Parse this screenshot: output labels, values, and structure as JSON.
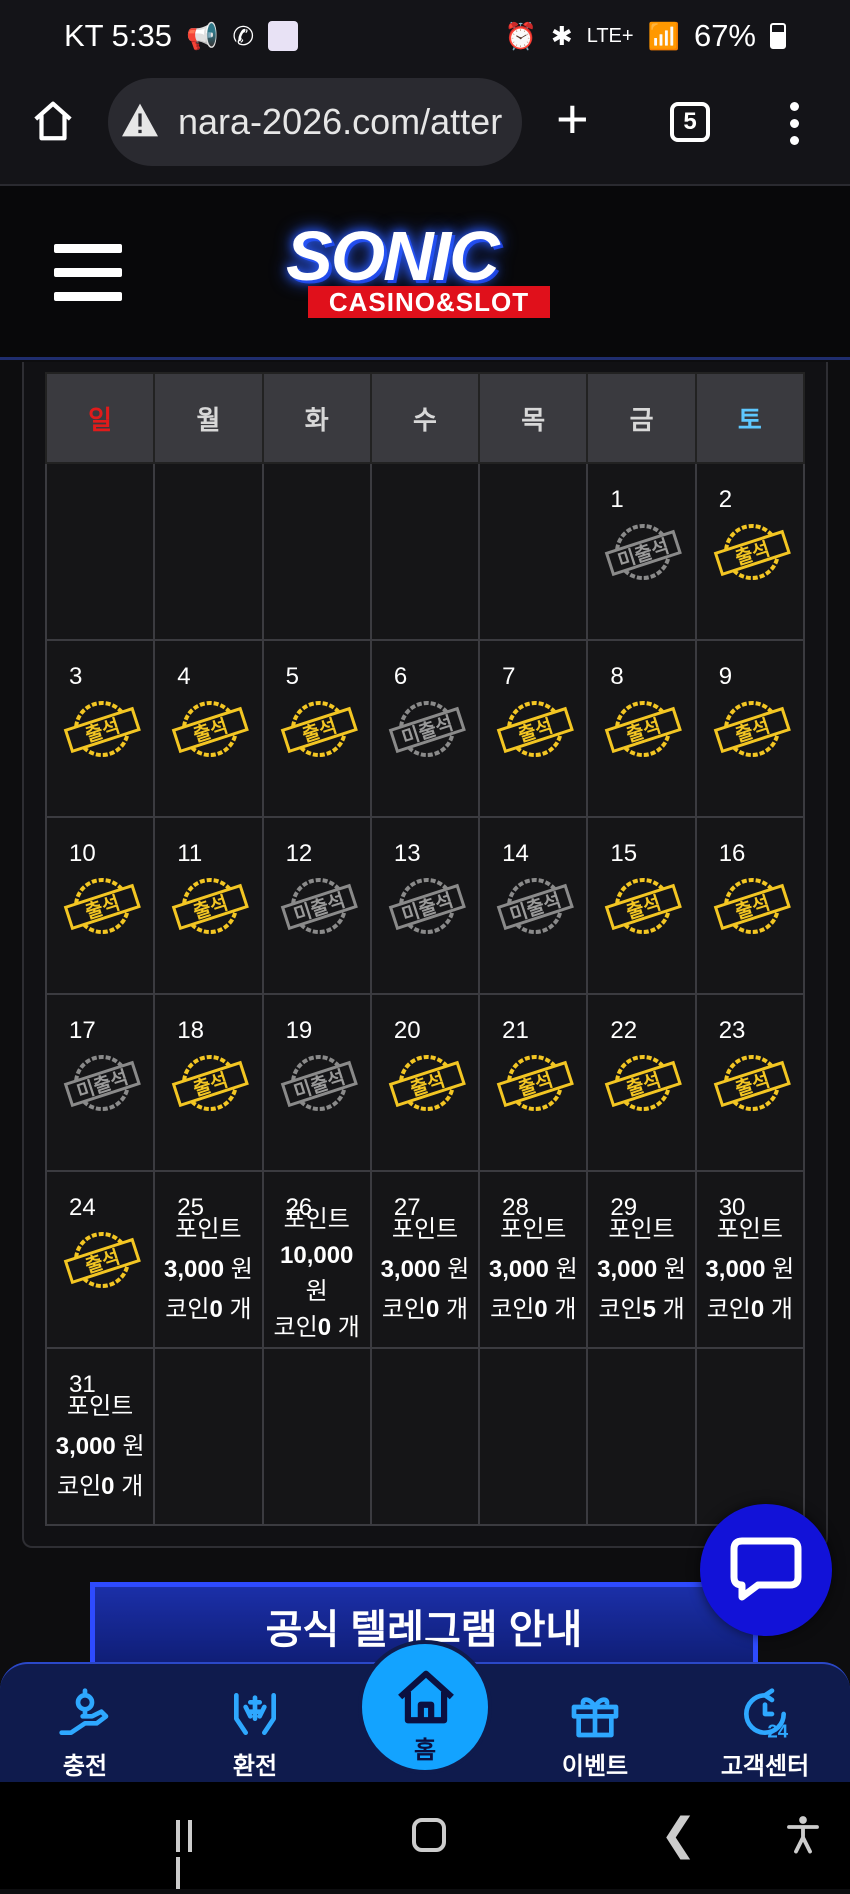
{
  "status_bar": {
    "carrier_time": "KT 5:35",
    "network": "LTE+",
    "battery": "67%"
  },
  "browser": {
    "url": "nara-2026.com/atter",
    "tab_count": "5"
  },
  "site": {
    "logo_word": "SONIC",
    "logo_sub": "CASINO&SLOT"
  },
  "calendar": {
    "weekdays": [
      "일",
      "월",
      "화",
      "수",
      "목",
      "금",
      "토"
    ],
    "attended_label": "출석",
    "missed_label": "미출석",
    "weeks": [
      [
        null,
        null,
        null,
        null,
        null,
        {
          "day": "1",
          "status": "missed"
        },
        {
          "day": "2",
          "status": "attended"
        }
      ],
      [
        {
          "day": "3",
          "status": "attended"
        },
        {
          "day": "4",
          "status": "attended"
        },
        {
          "day": "5",
          "status": "attended"
        },
        {
          "day": "6",
          "status": "missed"
        },
        {
          "day": "7",
          "status": "attended"
        },
        {
          "day": "8",
          "status": "attended"
        },
        {
          "day": "9",
          "status": "attended"
        }
      ],
      [
        {
          "day": "10",
          "status": "attended"
        },
        {
          "day": "11",
          "status": "attended"
        },
        {
          "day": "12",
          "status": "missed"
        },
        {
          "day": "13",
          "status": "missed"
        },
        {
          "day": "14",
          "status": "missed"
        },
        {
          "day": "15",
          "status": "attended"
        },
        {
          "day": "16",
          "status": "attended"
        }
      ],
      [
        {
          "day": "17",
          "status": "missed"
        },
        {
          "day": "18",
          "status": "attended"
        },
        {
          "day": "19",
          "status": "missed"
        },
        {
          "day": "20",
          "status": "attended"
        },
        {
          "day": "21",
          "status": "attended"
        },
        {
          "day": "22",
          "status": "attended"
        },
        {
          "day": "23",
          "status": "attended"
        }
      ],
      [
        {
          "day": "24",
          "status": "attended"
        },
        {
          "day": "25",
          "point_label": "포인트",
          "points": "3,000",
          "won": "원",
          "coin_label": "코인",
          "coins": "0",
          "unit": "개"
        },
        {
          "day": "26",
          "point_label": "포인트",
          "points": "10,000",
          "won": "원",
          "coin_label": "코인",
          "coins": "0",
          "unit": "개"
        },
        {
          "day": "27",
          "point_label": "포인트",
          "points": "3,000",
          "won": "원",
          "coin_label": "코인",
          "coins": "0",
          "unit": "개"
        },
        {
          "day": "28",
          "point_label": "포인트",
          "points": "3,000",
          "won": "원",
          "coin_label": "코인",
          "coins": "0",
          "unit": "개"
        },
        {
          "day": "29",
          "point_label": "포인트",
          "points": "3,000",
          "won": "원",
          "coin_label": "코인",
          "coins": "5",
          "unit": "개"
        },
        {
          "day": "30",
          "point_label": "포인트",
          "points": "3,000",
          "won": "원",
          "coin_label": "코인",
          "coins": "0",
          "unit": "개"
        }
      ],
      [
        {
          "day": "31",
          "point_label": "포인트",
          "points": "3,000",
          "won": "원",
          "coin_label": "코인",
          "coins": "0",
          "unit": "개"
        },
        null,
        null,
        null,
        null,
        null,
        null
      ]
    ]
  },
  "banner": {
    "text": "공식 텔레그램 안내"
  },
  "bottom_nav": {
    "charge": "충전",
    "exchange": "환전",
    "home": "홈",
    "event": "이벤트",
    "support": "고객센터"
  },
  "colors": {
    "accent_blue": "#13a3ff",
    "gold": "#f3c623",
    "sunday": "#e01b1b",
    "saturday": "#5ec8ff"
  }
}
